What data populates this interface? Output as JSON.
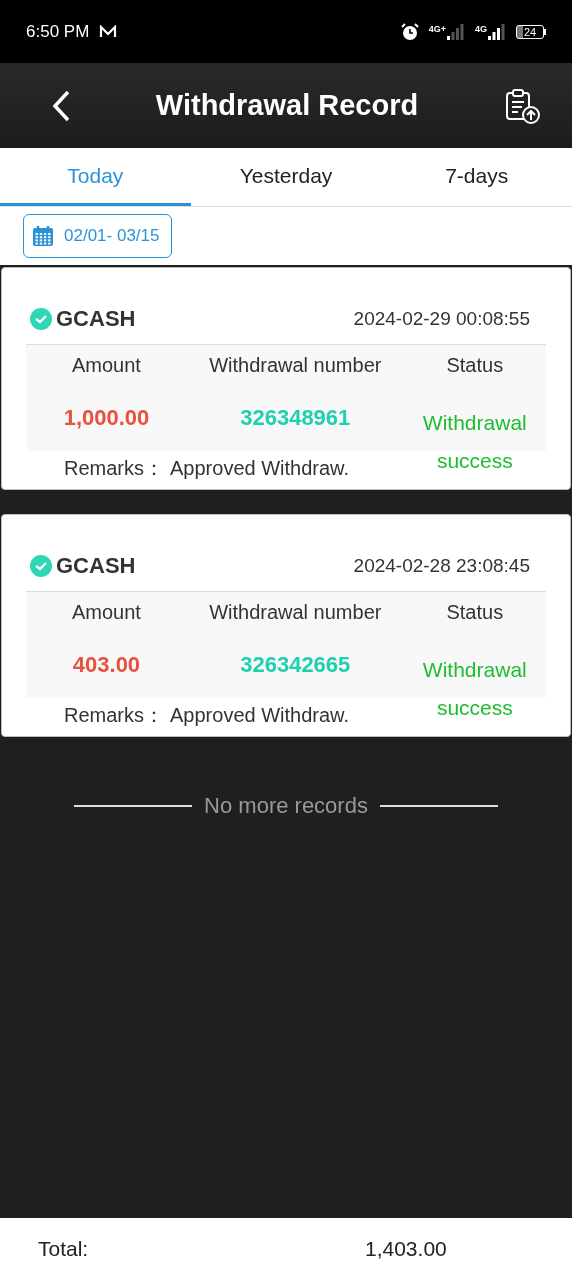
{
  "status_bar": {
    "time": "6:50 PM",
    "networks": [
      "4G+",
      "4G"
    ],
    "battery": "24"
  },
  "header": {
    "title": "Withdrawal Record"
  },
  "tabs": [
    {
      "label": "Today",
      "selected": true
    },
    {
      "label": "Yesterday",
      "selected": false
    },
    {
      "label": "7-days",
      "selected": false
    }
  ],
  "date_range": "02/01- 03/15",
  "records": [
    {
      "method": "GCASH",
      "time": "2024-02-29 00:08:55",
      "columns": [
        "Amount",
        "Withdrawal number",
        "Status"
      ],
      "amount": "1,000.00",
      "number": "326348961",
      "status": "Withdrawal success",
      "remarks_label": "Remarks：",
      "remarks": "Approved Withdraw."
    },
    {
      "method": "GCASH",
      "time": "2024-02-28 23:08:45",
      "columns": [
        "Amount",
        "Withdrawal number",
        "Status"
      ],
      "amount": "403.00",
      "number": "326342665",
      "status": "Withdrawal success",
      "remarks_label": "Remarks：",
      "remarks": "Approved Withdraw."
    }
  ],
  "end_note": "No more records",
  "footer": {
    "label": "Total:",
    "value": "1,403.00"
  }
}
